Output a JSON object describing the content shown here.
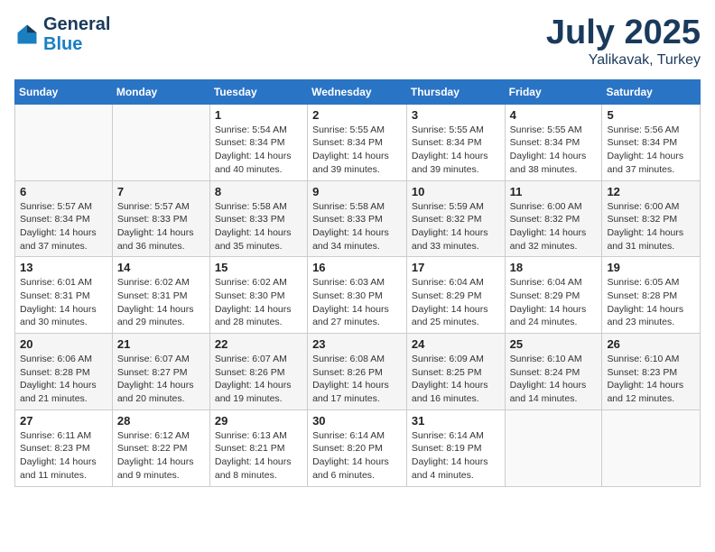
{
  "header": {
    "logo_line1": "General",
    "logo_line2": "Blue",
    "month": "July 2025",
    "location": "Yalikavak, Turkey"
  },
  "weekdays": [
    "Sunday",
    "Monday",
    "Tuesday",
    "Wednesday",
    "Thursday",
    "Friday",
    "Saturday"
  ],
  "weeks": [
    [
      {
        "day": "",
        "detail": ""
      },
      {
        "day": "",
        "detail": ""
      },
      {
        "day": "1",
        "detail": "Sunrise: 5:54 AM\nSunset: 8:34 PM\nDaylight: 14 hours and 40 minutes."
      },
      {
        "day": "2",
        "detail": "Sunrise: 5:55 AM\nSunset: 8:34 PM\nDaylight: 14 hours and 39 minutes."
      },
      {
        "day": "3",
        "detail": "Sunrise: 5:55 AM\nSunset: 8:34 PM\nDaylight: 14 hours and 39 minutes."
      },
      {
        "day": "4",
        "detail": "Sunrise: 5:55 AM\nSunset: 8:34 PM\nDaylight: 14 hours and 38 minutes."
      },
      {
        "day": "5",
        "detail": "Sunrise: 5:56 AM\nSunset: 8:34 PM\nDaylight: 14 hours and 37 minutes."
      }
    ],
    [
      {
        "day": "6",
        "detail": "Sunrise: 5:57 AM\nSunset: 8:34 PM\nDaylight: 14 hours and 37 minutes."
      },
      {
        "day": "7",
        "detail": "Sunrise: 5:57 AM\nSunset: 8:33 PM\nDaylight: 14 hours and 36 minutes."
      },
      {
        "day": "8",
        "detail": "Sunrise: 5:58 AM\nSunset: 8:33 PM\nDaylight: 14 hours and 35 minutes."
      },
      {
        "day": "9",
        "detail": "Sunrise: 5:58 AM\nSunset: 8:33 PM\nDaylight: 14 hours and 34 minutes."
      },
      {
        "day": "10",
        "detail": "Sunrise: 5:59 AM\nSunset: 8:32 PM\nDaylight: 14 hours and 33 minutes."
      },
      {
        "day": "11",
        "detail": "Sunrise: 6:00 AM\nSunset: 8:32 PM\nDaylight: 14 hours and 32 minutes."
      },
      {
        "day": "12",
        "detail": "Sunrise: 6:00 AM\nSunset: 8:32 PM\nDaylight: 14 hours and 31 minutes."
      }
    ],
    [
      {
        "day": "13",
        "detail": "Sunrise: 6:01 AM\nSunset: 8:31 PM\nDaylight: 14 hours and 30 minutes."
      },
      {
        "day": "14",
        "detail": "Sunrise: 6:02 AM\nSunset: 8:31 PM\nDaylight: 14 hours and 29 minutes."
      },
      {
        "day": "15",
        "detail": "Sunrise: 6:02 AM\nSunset: 8:30 PM\nDaylight: 14 hours and 28 minutes."
      },
      {
        "day": "16",
        "detail": "Sunrise: 6:03 AM\nSunset: 8:30 PM\nDaylight: 14 hours and 27 minutes."
      },
      {
        "day": "17",
        "detail": "Sunrise: 6:04 AM\nSunset: 8:29 PM\nDaylight: 14 hours and 25 minutes."
      },
      {
        "day": "18",
        "detail": "Sunrise: 6:04 AM\nSunset: 8:29 PM\nDaylight: 14 hours and 24 minutes."
      },
      {
        "day": "19",
        "detail": "Sunrise: 6:05 AM\nSunset: 8:28 PM\nDaylight: 14 hours and 23 minutes."
      }
    ],
    [
      {
        "day": "20",
        "detail": "Sunrise: 6:06 AM\nSunset: 8:28 PM\nDaylight: 14 hours and 21 minutes."
      },
      {
        "day": "21",
        "detail": "Sunrise: 6:07 AM\nSunset: 8:27 PM\nDaylight: 14 hours and 20 minutes."
      },
      {
        "day": "22",
        "detail": "Sunrise: 6:07 AM\nSunset: 8:26 PM\nDaylight: 14 hours and 19 minutes."
      },
      {
        "day": "23",
        "detail": "Sunrise: 6:08 AM\nSunset: 8:26 PM\nDaylight: 14 hours and 17 minutes."
      },
      {
        "day": "24",
        "detail": "Sunrise: 6:09 AM\nSunset: 8:25 PM\nDaylight: 14 hours and 16 minutes."
      },
      {
        "day": "25",
        "detail": "Sunrise: 6:10 AM\nSunset: 8:24 PM\nDaylight: 14 hours and 14 minutes."
      },
      {
        "day": "26",
        "detail": "Sunrise: 6:10 AM\nSunset: 8:23 PM\nDaylight: 14 hours and 12 minutes."
      }
    ],
    [
      {
        "day": "27",
        "detail": "Sunrise: 6:11 AM\nSunset: 8:23 PM\nDaylight: 14 hours and 11 minutes."
      },
      {
        "day": "28",
        "detail": "Sunrise: 6:12 AM\nSunset: 8:22 PM\nDaylight: 14 hours and 9 minutes."
      },
      {
        "day": "29",
        "detail": "Sunrise: 6:13 AM\nSunset: 8:21 PM\nDaylight: 14 hours and 8 minutes."
      },
      {
        "day": "30",
        "detail": "Sunrise: 6:14 AM\nSunset: 8:20 PM\nDaylight: 14 hours and 6 minutes."
      },
      {
        "day": "31",
        "detail": "Sunrise: 6:14 AM\nSunset: 8:19 PM\nDaylight: 14 hours and 4 minutes."
      },
      {
        "day": "",
        "detail": ""
      },
      {
        "day": "",
        "detail": ""
      }
    ]
  ]
}
